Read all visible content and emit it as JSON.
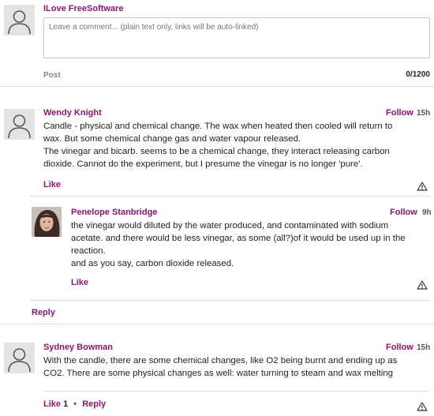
{
  "composer": {
    "user_name": "ILove FreeSoftware",
    "placeholder": "Leave a comment... (plain text only, links will be auto-linked)",
    "post_label": "Post",
    "char_count": "0/1200"
  },
  "comments": [
    {
      "author": "Wendy Knight",
      "follow_label": "Follow",
      "age": "15h",
      "lines": [
        "Candle - physical and chemical change. The wax when heated then cooled will return to",
        "wax. But some chemical change gas and water vapour released.",
        "The vinegar and bicarb. seems to be a chemical change, they interact releasing carbon",
        "dioxide. Cannot do the experiment, but I presume the vinegar is no longer 'pure'."
      ],
      "like_label": "Like",
      "flag_icon": "warning-triangle-icon",
      "reply": {
        "author": "Penelope Stanbridge",
        "follow_label": "Follow",
        "age": "9h",
        "lines": [
          "the vinegar would diluted by the water produced, and contaminated with sodium",
          "acetate. and there would be less vinegar, as some (all?)of it would be used up in the",
          "reaction.",
          "and as you say, carbon dioxide released."
        ],
        "like_label": "Like"
      },
      "reply_label": "Reply"
    },
    {
      "author": "Sydney Bowman",
      "follow_label": "Follow",
      "age": "15h",
      "lines": [
        "With the candle, there are some chemical changes, like O2 being burnt and ending up as",
        "CO2. There are some physical changes as well: water turning to steam and wax melting"
      ],
      "like_label": "Like",
      "like_count": "1",
      "separator": "•",
      "reply_label": "Reply"
    }
  ],
  "colors": {
    "accent": "#8a1572",
    "divider": "#dcdcdc",
    "avatar_bg": "#e3e3e3"
  }
}
